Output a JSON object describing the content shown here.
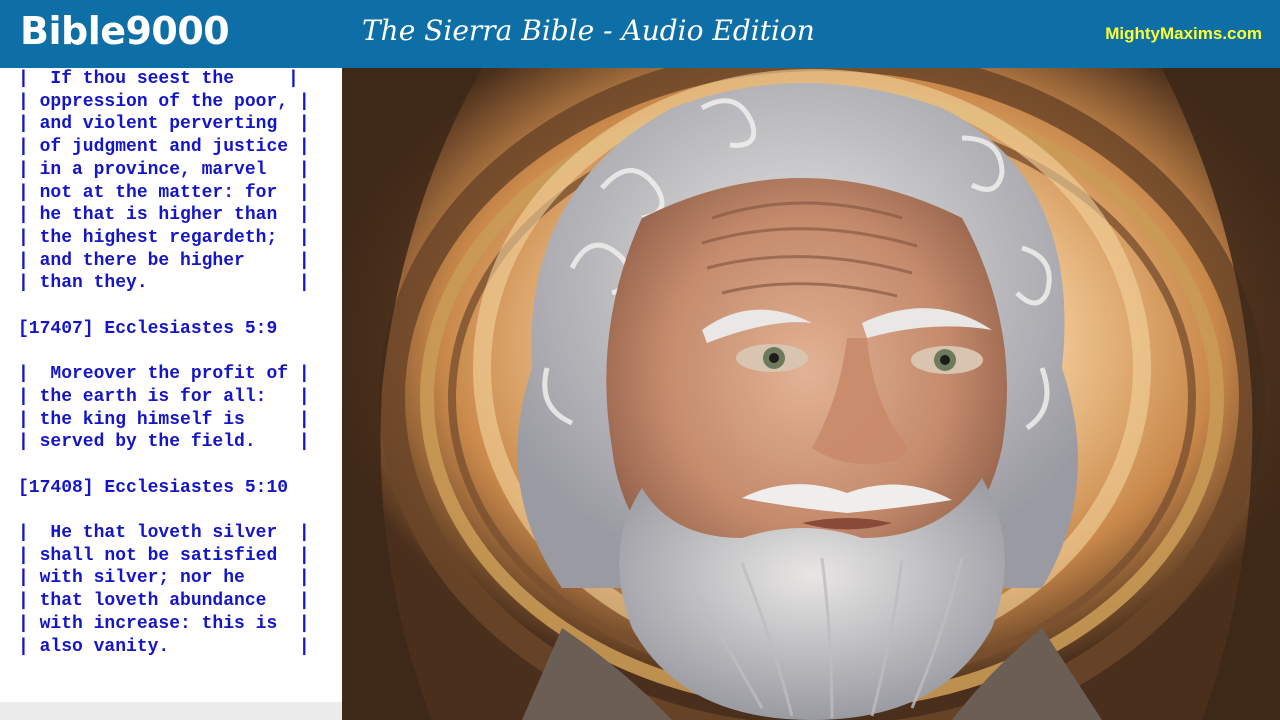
{
  "header": {
    "brand": "Bible9000",
    "title": "The Sierra Bible - Audio Edition",
    "site": "MightyMaxims.com"
  },
  "scripture": {
    "lines": [
      "|  If thou seest the     |",
      "| oppression of the poor, |",
      "| and violent perverting  |",
      "| of judgment and justice |",
      "| in a province, marvel   |",
      "| not at the matter: for  |",
      "| he that is higher than  |",
      "| the highest regardeth;  |",
      "| and there be higher     |",
      "| than they.              |",
      "",
      "[17407] Ecclesiastes 5:9",
      "",
      "|  Moreover the profit of |",
      "| the earth is for all:   |",
      "| the king himself is     |",
      "| served by the field.    |",
      "",
      "[17408] Ecclesiastes 5:10",
      "",
      "|  He that loveth silver  |",
      "| shall not be satisfied  |",
      "| with silver; nor he     |",
      "| that loveth abundance   |",
      "| with increase: this is  |",
      "| also vanity.            |"
    ]
  },
  "colors": {
    "header_bg": "#0d6fa6",
    "scripture_text": "#1414c8",
    "site_link": "#ffff33"
  }
}
